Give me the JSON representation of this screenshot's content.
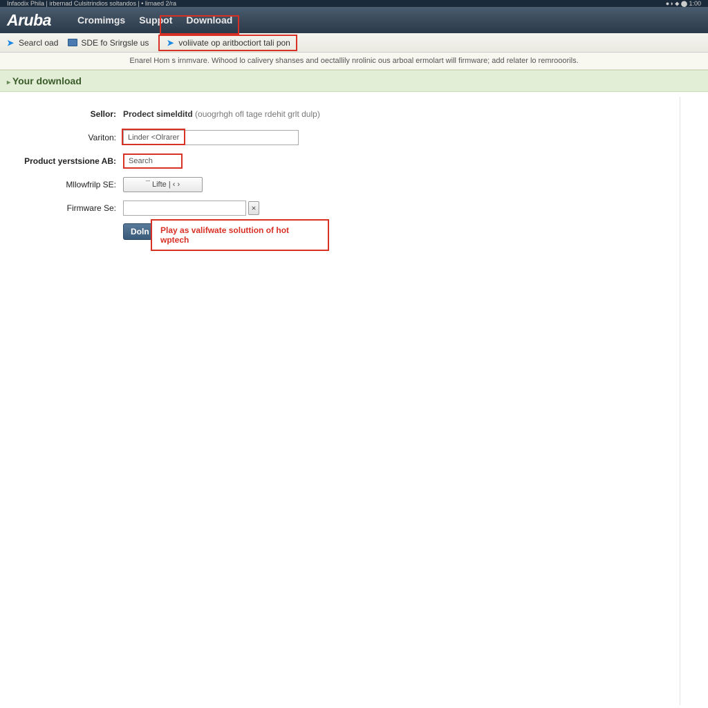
{
  "topstrip": {
    "left": "Infaodix   Phila   |   irbernad   Culsitrindios   soltandos    |   • lirnaed 2/ra",
    "right": "●◑ ⬥   ⬤ 1:00"
  },
  "header": {
    "logo": "Aruba",
    "nav": [
      "Cromimgs",
      "Suppot",
      "Download"
    ]
  },
  "toolbar": {
    "items": [
      {
        "icon": "arrow",
        "label": "Searcl oad"
      },
      {
        "icon": "screen",
        "label": "SDE fo Srirgsle us"
      },
      {
        "icon": "arrow",
        "label": "voliivate op aritboctiort tali pon"
      }
    ]
  },
  "info_banner": "Enarel Hom s irnmvare. Wihood lo calivery shanses and oectallily nrolinic ous arboal ermolart will firmware; add relater lo remrooorils.",
  "section_title": "Your download",
  "form": {
    "seller": {
      "label": "Sellor:",
      "value_bold": "Prodect simelditd",
      "value_hint": "(ouogrhgh ofl tage rdehit grlt dulp)"
    },
    "version": {
      "label": "Variton:",
      "value": "Linder <Olrarer"
    },
    "product_version": {
      "label": "Product yerstsione  AB:",
      "value": "Search"
    },
    "mllowhlp": {
      "label": "Mllowfrilp SE:",
      "value": "¯ Lifte | ‹ ›"
    },
    "firmware": {
      "label": "Firmware Se:",
      "btn": "⨯"
    },
    "submit": "Doln"
  },
  "callout": "Play as valifwate soluttion of hot wptech"
}
